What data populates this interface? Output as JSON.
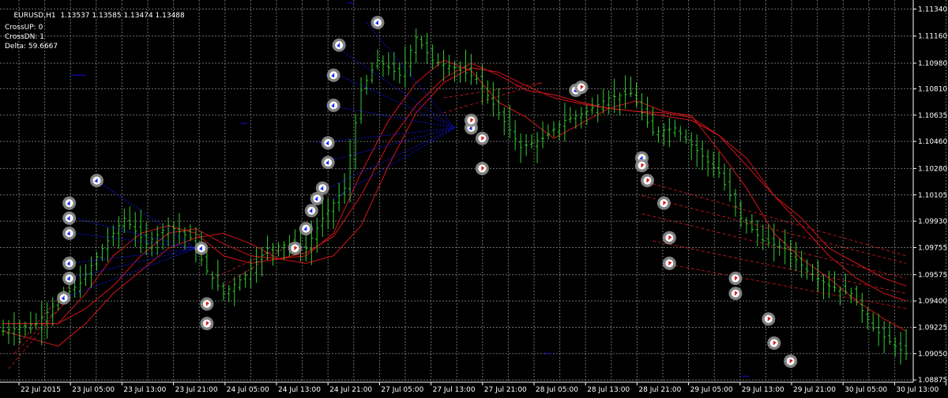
{
  "header": {
    "symbol_timeframe": "EURUSD,H1",
    "ohlc": "1.13537 1.13585 1.13474 1.13488"
  },
  "indicator_text": {
    "cross_up": "CrossUP: 0",
    "cross_dn": "CrossDN: 1",
    "delta": "Delta: 59.6667"
  },
  "colors": {
    "background": "#000000",
    "grid": "#6e6e6e",
    "candle": "#33cc33",
    "ma": "#d4141a",
    "ma_dashed": "#b0141a",
    "blue_lines": "#1010e0",
    "marker_ring": "#8e8e8e",
    "arrow_up": "#1a2cff",
    "arrow_down": "#e01818",
    "axis_text": "#ffffff"
  },
  "chart_data": {
    "type": "candlestick",
    "ylim": [
      1.0886,
      1.114
    ],
    "y_ticks": [
      "1.11340",
      "1.11160",
      "1.10980",
      "1.10810",
      "1.10635",
      "1.10460",
      "1.10280",
      "1.10105",
      "1.09930",
      "1.09755",
      "1.09575",
      "1.09400",
      "1.09225",
      "1.09050",
      "1.08875"
    ],
    "x_ticks": [
      "22 Jul 2015",
      "23 Jul 05:00",
      "23 Jul 13:00",
      "23 Jul 21:00",
      "24 Jul 05:00",
      "24 Jul 13:00",
      "24 Jul 21:00",
      "27 Jul 05:00",
      "27 Jul 13:00",
      "27 Jul 21:00",
      "28 Jul 05:00",
      "28 Jul 13:00",
      "28 Jul 21:00",
      "29 Jul 05:00",
      "29 Jul 13:00",
      "29 Jul 21:00",
      "30 Jul 05:00",
      "30 Jul 13:00",
      "30 Jul 21:00"
    ],
    "price_anchors": [
      [
        0,
        1.092
      ],
      [
        6,
        1.0925
      ],
      [
        10,
        1.094
      ],
      [
        14,
        1.0952
      ],
      [
        18,
        1.0975
      ],
      [
        22,
        1.0995
      ],
      [
        26,
        1.0978
      ],
      [
        30,
        1.099
      ],
      [
        34,
        1.0982
      ],
      [
        37,
        1.096
      ],
      [
        40,
        1.0945
      ],
      [
        44,
        1.0957
      ],
      [
        48,
        1.0975
      ],
      [
        52,
        1.0978
      ],
      [
        55,
        1.0975
      ],
      [
        58,
        1.0995
      ],
      [
        62,
        1.1015
      ],
      [
        65,
        1.108
      ],
      [
        68,
        1.11
      ],
      [
        72,
        1.109
      ],
      [
        75,
        1.1115
      ],
      [
        78,
        1.11
      ],
      [
        82,
        1.1095
      ],
      [
        86,
        1.1088
      ],
      [
        90,
        1.1065
      ],
      [
        94,
        1.1042
      ],
      [
        98,
        1.1048
      ],
      [
        102,
        1.106
      ],
      [
        106,
        1.1066
      ],
      [
        110,
        1.1075
      ],
      [
        114,
        1.1078
      ],
      [
        118,
        1.1052
      ],
      [
        122,
        1.1055
      ],
      [
        126,
        1.104
      ],
      [
        130,
        1.1025
      ],
      [
        134,
        1.0995
      ],
      [
        138,
        1.098
      ],
      [
        142,
        1.0975
      ],
      [
        146,
        1.096
      ],
      [
        150,
        1.095
      ],
      [
        154,
        1.0945
      ],
      [
        158,
        1.0922
      ],
      [
        162,
        1.091
      ],
      [
        164,
        1.0905
      ]
    ],
    "ma_lines": [
      {
        "style": "solid",
        "points": [
          [
            0,
            1.0925
          ],
          [
            10,
            1.0925
          ],
          [
            15,
            1.0945
          ],
          [
            20,
            1.097
          ],
          [
            25,
            1.0985
          ],
          [
            30,
            1.099
          ],
          [
            35,
            1.0985
          ],
          [
            40,
            1.097
          ],
          [
            45,
            1.0965
          ],
          [
            50,
            1.0968
          ],
          [
            55,
            1.097
          ],
          [
            60,
            1.0985
          ],
          [
            65,
            1.1025
          ],
          [
            70,
            1.106
          ],
          [
            75,
            1.1085
          ],
          [
            80,
            1.11
          ],
          [
            85,
            1.1093
          ],
          [
            90,
            1.1072
          ],
          [
            95,
            1.1062
          ],
          [
            100,
            1.1048
          ],
          [
            105,
            1.1058
          ],
          [
            110,
            1.1068
          ],
          [
            115,
            1.1073
          ],
          [
            120,
            1.1066
          ],
          [
            125,
            1.1063
          ],
          [
            130,
            1.104
          ],
          [
            135,
            1.1015
          ],
          [
            140,
            1.0985
          ],
          [
            145,
            1.0968
          ],
          [
            150,
            1.0955
          ],
          [
            155,
            1.094
          ],
          [
            160,
            1.0928
          ],
          [
            164,
            1.092
          ]
        ]
      },
      {
        "style": "solid",
        "points": [
          [
            0,
            1.0925
          ],
          [
            10,
            1.0925
          ],
          [
            15,
            1.0935
          ],
          [
            20,
            1.095
          ],
          [
            25,
            1.097
          ],
          [
            30,
            1.0985
          ],
          [
            35,
            1.0988
          ],
          [
            40,
            1.0978
          ],
          [
            45,
            1.097
          ],
          [
            50,
            1.0968
          ],
          [
            55,
            1.0972
          ],
          [
            60,
            1.0983
          ],
          [
            65,
            1.101
          ],
          [
            70,
            1.1045
          ],
          [
            75,
            1.107
          ],
          [
            80,
            1.1088
          ],
          [
            85,
            1.1098
          ],
          [
            90,
            1.109
          ],
          [
            95,
            1.108
          ],
          [
            100,
            1.1077
          ],
          [
            105,
            1.1072
          ],
          [
            110,
            1.1068
          ],
          [
            115,
            1.1066
          ],
          [
            120,
            1.1065
          ],
          [
            125,
            1.1062
          ],
          [
            130,
            1.105
          ],
          [
            135,
            1.103
          ],
          [
            140,
            1.101
          ],
          [
            145,
            1.099
          ],
          [
            150,
            1.097
          ],
          [
            155,
            1.0955
          ],
          [
            160,
            1.0945
          ],
          [
            164,
            1.094
          ]
        ]
      },
      {
        "style": "solid",
        "points": [
          [
            0,
            1.092
          ],
          [
            10,
            1.091
          ],
          [
            15,
            1.0925
          ],
          [
            20,
            1.0945
          ],
          [
            25,
            1.096
          ],
          [
            30,
            1.0975
          ],
          [
            35,
            1.0982
          ],
          [
            40,
            1.0985
          ],
          [
            45,
            1.0978
          ],
          [
            50,
            1.0968
          ],
          [
            55,
            1.0965
          ],
          [
            60,
            1.097
          ],
          [
            65,
            1.099
          ],
          [
            70,
            1.103
          ],
          [
            75,
            1.1065
          ],
          [
            80,
            1.1085
          ],
          [
            85,
            1.1095
          ],
          [
            90,
            1.1092
          ],
          [
            95,
            1.1083
          ],
          [
            100,
            1.1075
          ],
          [
            105,
            1.1071
          ],
          [
            110,
            1.1068
          ],
          [
            115,
            1.1066
          ],
          [
            120,
            1.1063
          ],
          [
            125,
            1.106
          ],
          [
            130,
            1.105
          ],
          [
            135,
            1.1035
          ],
          [
            140,
            1.101
          ],
          [
            145,
            1.0995
          ],
          [
            150,
            1.0975
          ],
          [
            155,
            1.0965
          ],
          [
            160,
            1.0955
          ],
          [
            164,
            1.095
          ]
        ]
      }
    ],
    "dashed_lines": [
      [
        [
          1,
          1.0895
        ],
        [
          11,
          1.0938
        ]
      ],
      [
        [
          2,
          1.0905
        ],
        [
          11,
          1.0938
        ]
      ],
      [
        [
          3,
          1.0912
        ],
        [
          12,
          1.095
        ]
      ],
      [
        [
          38,
          1.0955
        ],
        [
          50,
          1.0975
        ]
      ],
      [
        [
          40,
          1.095
        ],
        [
          51,
          1.0975
        ]
      ],
      [
        [
          80,
          1.1075
        ],
        [
          98,
          1.1085
        ]
      ],
      [
        [
          80,
          1.1065
        ],
        [
          98,
          1.1085
        ]
      ],
      [
        [
          116,
          1.102
        ],
        [
          164,
          1.097
        ]
      ],
      [
        [
          116,
          1.101
        ],
        [
          164,
          1.0965
        ]
      ],
      [
        [
          116,
          1.0998
        ],
        [
          164,
          1.0955
        ]
      ],
      [
        [
          118,
          1.098
        ],
        [
          164,
          1.0945
        ]
      ],
      [
        [
          120,
          1.0965
        ],
        [
          164,
          1.0935
        ]
      ]
    ],
    "blue_lines": [
      [
        [
          11,
          1.0942
        ],
        [
          35,
          1.0975
        ]
      ],
      [
        [
          12,
          1.0955
        ],
        [
          35,
          1.0975
        ]
      ],
      [
        [
          12,
          1.0965
        ],
        [
          35,
          1.0975
        ]
      ],
      [
        [
          13,
          1.0985
        ],
        [
          35,
          1.0975
        ]
      ],
      [
        [
          13,
          1.0995
        ],
        [
          35,
          1.0975
        ]
      ],
      [
        [
          17,
          1.102
        ],
        [
          35,
          1.0975
        ]
      ],
      [
        [
          57,
          1.1045
        ],
        [
          82,
          1.1055
        ]
      ],
      [
        [
          58,
          1.1032
        ],
        [
          82,
          1.1055
        ]
      ],
      [
        [
          59,
          1.1015
        ],
        [
          82,
          1.1055
        ]
      ],
      [
        [
          60,
          1.1008
        ],
        [
          82,
          1.1055
        ]
      ],
      [
        [
          59,
          1.107
        ],
        [
          82,
          1.1055
        ]
      ],
      [
        [
          61,
          1.109
        ],
        [
          82,
          1.1055
        ]
      ],
      [
        [
          60,
          1.111
        ],
        [
          82,
          1.1055
        ]
      ],
      [
        [
          66,
          1.1125
        ],
        [
          82,
          1.1055
        ]
      ]
    ],
    "markers": [
      {
        "i": 11,
        "price": 1.0942,
        "dir": "up"
      },
      {
        "i": 12,
        "price": 1.0955,
        "dir": "up"
      },
      {
        "i": 12,
        "price": 1.0965,
        "dir": "up"
      },
      {
        "i": 12,
        "price": 1.0985,
        "dir": "up"
      },
      {
        "i": 12,
        "price": 1.0995,
        "dir": "up"
      },
      {
        "i": 12,
        "price": 1.1005,
        "dir": "up"
      },
      {
        "i": 17,
        "price": 1.102,
        "dir": "up"
      },
      {
        "i": 36,
        "price": 1.0975,
        "dir": "up"
      },
      {
        "i": 37,
        "price": 1.0938,
        "dir": "down"
      },
      {
        "i": 37,
        "price": 1.0925,
        "dir": "down"
      },
      {
        "i": 53,
        "price": 1.0975,
        "dir": "down"
      },
      {
        "i": 55,
        "price": 1.0988,
        "dir": "up"
      },
      {
        "i": 56,
        "price": 1.1,
        "dir": "up"
      },
      {
        "i": 57,
        "price": 1.1008,
        "dir": "up"
      },
      {
        "i": 58,
        "price": 1.1015,
        "dir": "up"
      },
      {
        "i": 59,
        "price": 1.1032,
        "dir": "up"
      },
      {
        "i": 59,
        "price": 1.1045,
        "dir": "up"
      },
      {
        "i": 60,
        "price": 1.107,
        "dir": "up"
      },
      {
        "i": 60,
        "price": 1.109,
        "dir": "up"
      },
      {
        "i": 61,
        "price": 1.111,
        "dir": "up"
      },
      {
        "i": 68,
        "price": 1.1125,
        "dir": "up"
      },
      {
        "i": 85,
        "price": 1.1055,
        "dir": "up"
      },
      {
        "i": 85,
        "price": 1.106,
        "dir": "down"
      },
      {
        "i": 87,
        "price": 1.1048,
        "dir": "down"
      },
      {
        "i": 87,
        "price": 1.1028,
        "dir": "down"
      },
      {
        "i": 104,
        "price": 1.108,
        "dir": "up"
      },
      {
        "i": 105,
        "price": 1.1082,
        "dir": "down"
      },
      {
        "i": 116,
        "price": 1.1035,
        "dir": "up"
      },
      {
        "i": 116,
        "price": 1.103,
        "dir": "down"
      },
      {
        "i": 117,
        "price": 1.102,
        "dir": "down"
      },
      {
        "i": 120,
        "price": 1.1005,
        "dir": "down"
      },
      {
        "i": 121,
        "price": 1.0982,
        "dir": "down"
      },
      {
        "i": 121,
        "price": 1.0965,
        "dir": "down"
      },
      {
        "i": 133,
        "price": 1.0955,
        "dir": "down"
      },
      {
        "i": 133,
        "price": 1.0945,
        "dir": "down"
      },
      {
        "i": 139,
        "price": 1.0928,
        "dir": "down"
      },
      {
        "i": 140,
        "price": 1.0912,
        "dir": "down"
      },
      {
        "i": 143,
        "price": 1.09,
        "dir": "down"
      }
    ]
  }
}
